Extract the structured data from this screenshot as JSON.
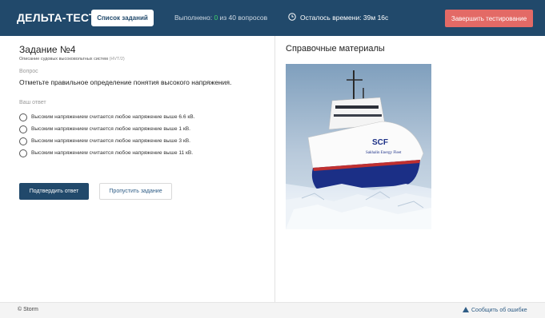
{
  "header": {
    "brand": "ДЕЛЬТА-ТЕСТ",
    "tasks_button": "Список заданий",
    "progress_prefix": "Выполнено: ",
    "progress_done": "0",
    "progress_suffix": " из 40 вопросов",
    "timer_label": "Осталось времени: 39м 16с",
    "timer_icon": "clock-icon",
    "finish_button": "Завершить тестирование"
  },
  "task": {
    "title": "Задание №4",
    "subject": "Описание судовых высоковольтных систем ",
    "subject_code": "(HVT/2)",
    "question_label": "Вопрос",
    "question_text": "Отметьте правильное определение понятия высокого напряжения.",
    "answer_label": "Ваш ответ",
    "options": [
      "Высоким напряжением считается любое напряжение выше 6.6 кВ.",
      "Высоким напряжением считается любое напряжение выше 1 кВ.",
      "Высоким напряжением считается любое напряжение выше 3 кВ.",
      "Высоким напряжением считается любое напряжение выше 11 кВ."
    ],
    "submit_button": "Подтвердить ответ",
    "skip_button": "Пропустить задание"
  },
  "reference": {
    "title": "Справочные материалы",
    "image_logo": "SCF",
    "image_ship_name": "Sakhalin Energy Fleet"
  },
  "footer": {
    "copyright": "© Storm",
    "report_icon": "warning-triangle-icon",
    "report_link": "Сообщить об ошибке"
  },
  "colors": {
    "header_bg": "#21496b",
    "finish_button_bg": "#e36a66",
    "progress_done": "#3fd36b",
    "primary_button_bg": "#21496b"
  }
}
